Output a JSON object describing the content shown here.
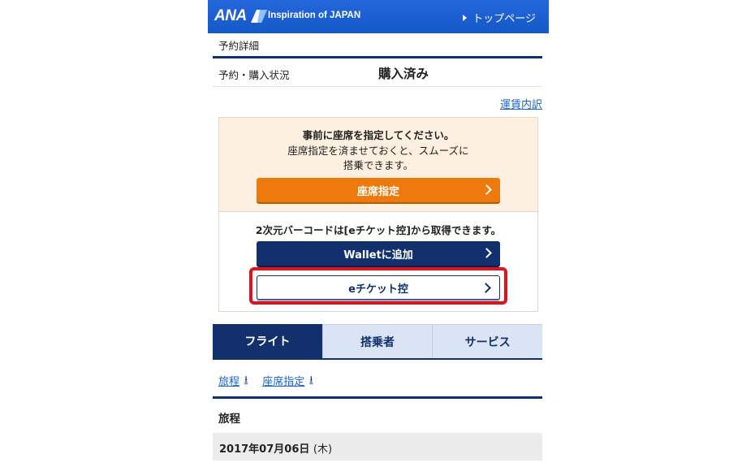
{
  "header": {
    "logo": "ANA",
    "tagline": "Inspiration of JAPAN",
    "top_link": "トップページ",
    "icon": "triangle-right-icon"
  },
  "section_title": "予約詳細",
  "status": {
    "label": "予約・購入状況",
    "value": "購入済み"
  },
  "fare_link": "運賃内訳",
  "seat_box": {
    "heading": "事前に座席を指定してください。",
    "line2": "座席指定を済ませておくと、スムーズに",
    "line3": "搭乗できます。",
    "button": "座席指定"
  },
  "ticket_box": {
    "message": "2次元バーコードは[eチケット控]から取得できます。",
    "wallet_button": "Walletに追加",
    "eticket_button": "eチケット控"
  },
  "tabs": [
    {
      "label": "フライト",
      "active": true
    },
    {
      "label": "搭乗者",
      "active": false
    },
    {
      "label": "サービス",
      "active": false
    }
  ],
  "anchors": [
    {
      "label": "旅程",
      "icon": "down-arrow-icon"
    },
    {
      "label": "座席指定",
      "icon": "down-arrow-icon"
    }
  ],
  "itinerary": {
    "title": "旅程",
    "date": "2017年07月06日",
    "day": "(木)"
  },
  "colors": {
    "header_blue": "#1a5fd4",
    "navy": "#12306e",
    "orange": "#ee7a0e",
    "highlight_red": "#e0121b",
    "link_blue": "#1a66c9"
  }
}
